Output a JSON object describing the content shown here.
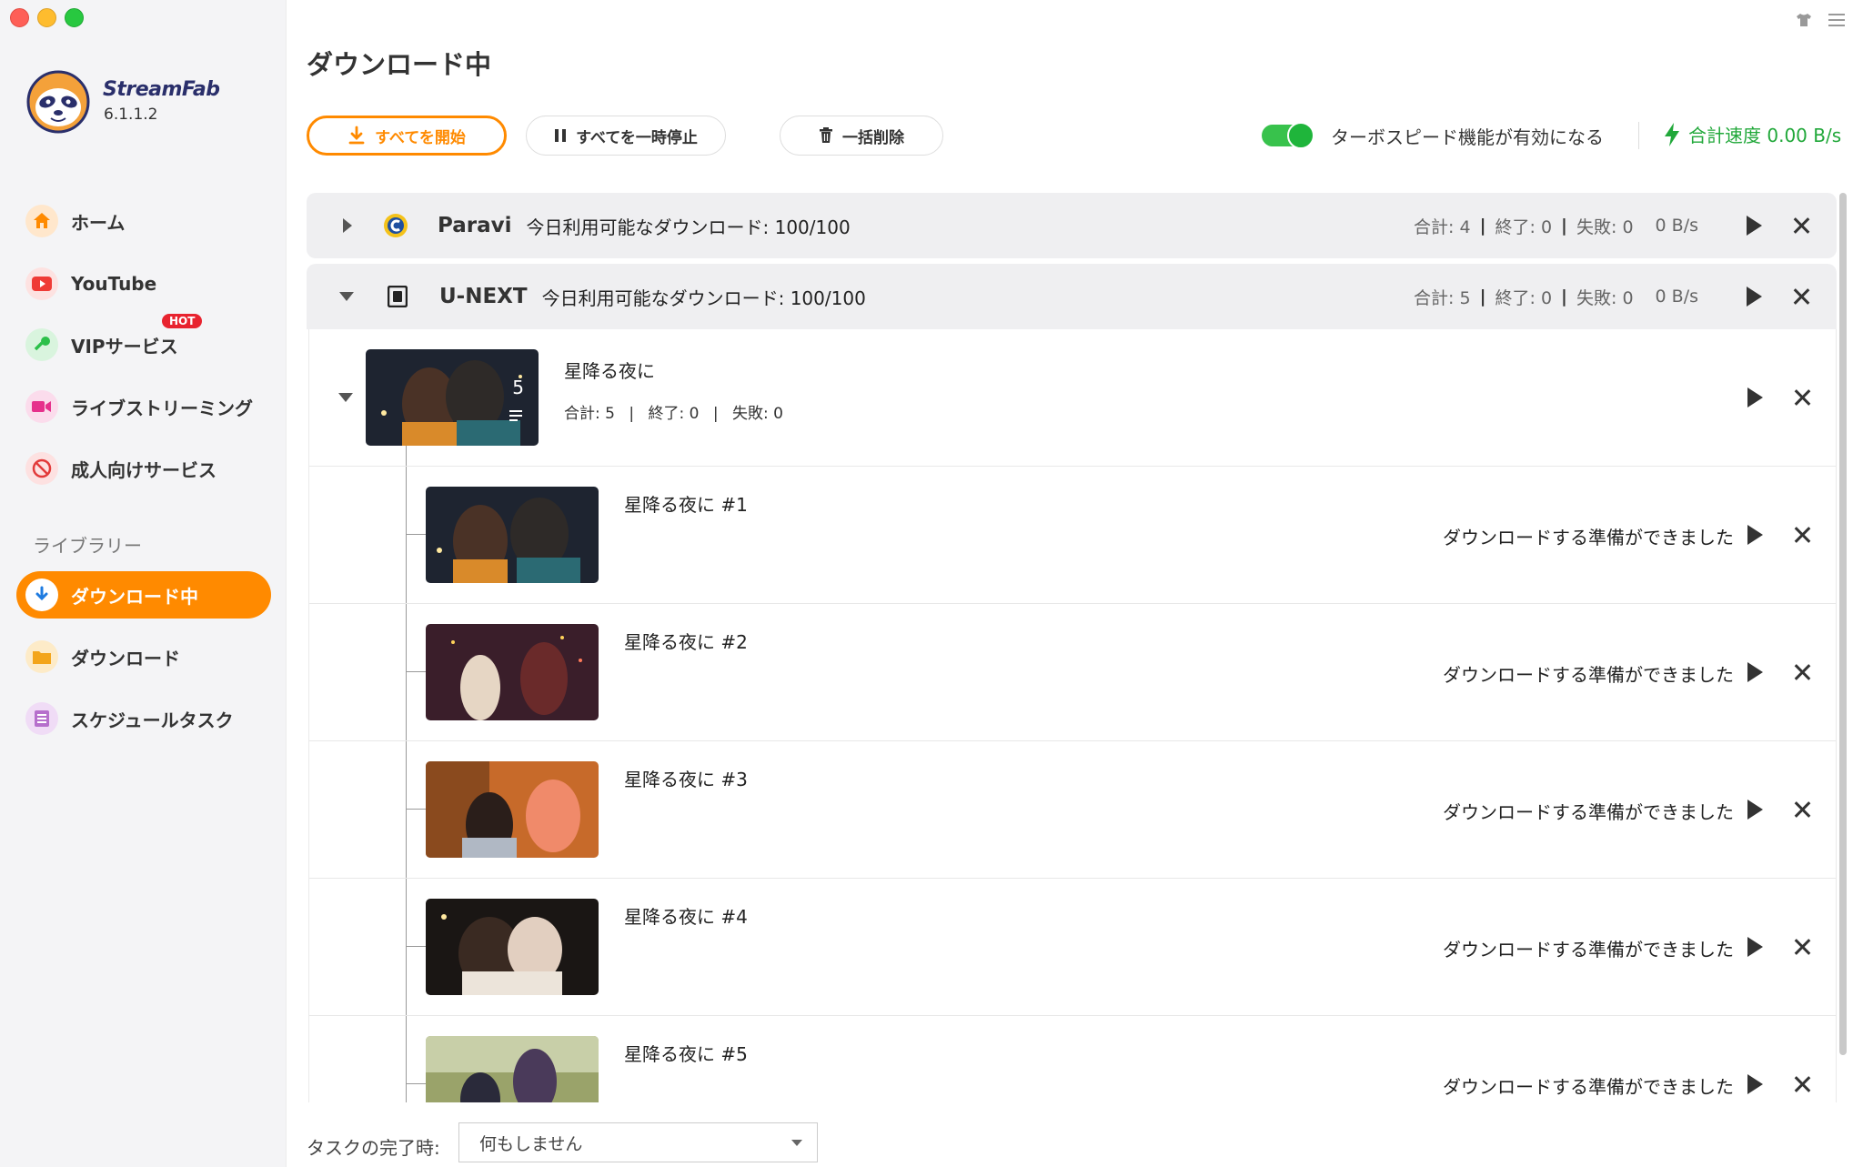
{
  "app": {
    "brand": "StreamFab",
    "version": "6.1.1.2"
  },
  "sidebar": {
    "items": [
      {
        "label": "ホーム",
        "icon": "home-icon",
        "color": "#ff8a00"
      },
      {
        "label": "YouTube",
        "icon": "youtube-icon",
        "color": "#ef3b36"
      },
      {
        "label": "VIPサービス",
        "icon": "key-icon",
        "color": "#2cc04a",
        "badge": "HOT"
      },
      {
        "label": "ライブストリーミング",
        "icon": "live-camera-icon",
        "color": "#e6318c"
      },
      {
        "label": "成人向けサービス",
        "icon": "adult-restricted-icon",
        "color": "#e23a3a"
      }
    ],
    "library_label": "ライブラリー",
    "library_items": [
      {
        "label": "ダウンロード中",
        "icon": "download-arrow-icon",
        "active": true
      },
      {
        "label": "ダウンロード",
        "icon": "folder-icon",
        "color": "#f3a51b"
      },
      {
        "label": "スケジュールタスク",
        "icon": "schedule-list-icon",
        "color": "#b66fcc"
      }
    ]
  },
  "main": {
    "title": "ダウンロード中",
    "toolbar": {
      "start_all": "すべてを開始",
      "pause_all": "すべてを一時停止",
      "delete_all": "一括削除"
    },
    "turbo": {
      "label": "ターボスピード機能が有効になる",
      "enabled": true
    },
    "speed": "合計速度 0.00 B/s"
  },
  "groups": [
    {
      "service": "Paravi",
      "quota": "今日利用可能なダウンロード: 100/100",
      "total": "合計: 4",
      "done": "終了: 0",
      "failed": "失敗: 0",
      "speed": "0 B/s",
      "expanded": false
    },
    {
      "service": "U-NEXT",
      "quota": "今日利用可能なダウンロード: 100/100",
      "total": "合計: 5",
      "done": "終了: 0",
      "failed": "失敗: 0",
      "speed": "0 B/s",
      "expanded": true
    }
  ],
  "series": {
    "title": "星降る夜に",
    "count": "5",
    "total": "合計: 5",
    "done": "終了: 0",
    "failed": "失敗: 0"
  },
  "episodes": [
    {
      "title": "星降る夜に #1",
      "status": "ダウンロードする準備ができました"
    },
    {
      "title": "星降る夜に #2",
      "status": "ダウンロードする準備ができました"
    },
    {
      "title": "星降る夜に #3",
      "status": "ダウンロードする準備ができました"
    },
    {
      "title": "星降る夜に #4",
      "status": "ダウンロードする準備ができました"
    },
    {
      "title": "星降る夜に #5",
      "status": "ダウンロードする準備ができました"
    }
  ],
  "footer": {
    "task_label": "タスクの完了時:",
    "task_value": "何もしません"
  },
  "colors": {
    "accent": "#ff8a00",
    "turbo_green": "#21a83a"
  }
}
